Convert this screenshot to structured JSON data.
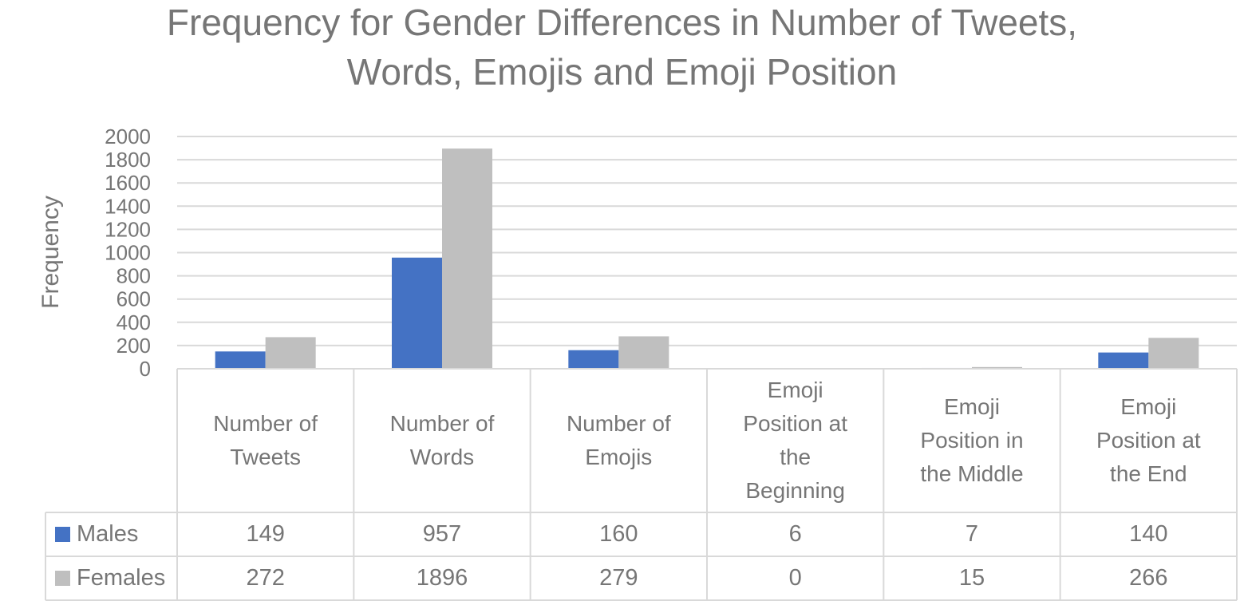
{
  "chart_data": {
    "type": "bar",
    "title_lines": [
      "Frequency for Gender Differences in Number of Tweets,",
      "Words, Emojis and Emoji Position"
    ],
    "title": "Frequency for Gender Differences in Number of Tweets, Words, Emojis and Emoji Position",
    "xlabel": "",
    "ylabel": "Frequency",
    "ylim": [
      0,
      2000
    ],
    "yticks": [
      0,
      200,
      400,
      600,
      800,
      1000,
      1200,
      1400,
      1600,
      1800,
      2000
    ],
    "grid": true,
    "legend_placement": "data-table-left",
    "categories": [
      "Number of Tweets",
      "Number of Words",
      "Number of Emojis",
      "Emoji Position at the Beginning",
      "Emoji Position in the Middle",
      "Emoji Position at the End"
    ],
    "category_label_lines": [
      [
        "Number of",
        "Tweets"
      ],
      [
        "Number of",
        "Words"
      ],
      [
        "Number of",
        "Emojis"
      ],
      [
        "Emoji",
        "Position at",
        "the",
        "Beginning"
      ],
      [
        "Emoji",
        "Position in",
        "the Middle"
      ],
      [
        "Emoji",
        "Position at",
        "the End"
      ]
    ],
    "series": [
      {
        "name": "Males",
        "color": "#4472C4",
        "values": [
          149,
          957,
          160,
          6,
          7,
          140
        ]
      },
      {
        "name": "Females",
        "color": "#BFBFBF",
        "values": [
          272,
          1896,
          279,
          0,
          15,
          266
        ]
      }
    ],
    "data_table": true
  }
}
